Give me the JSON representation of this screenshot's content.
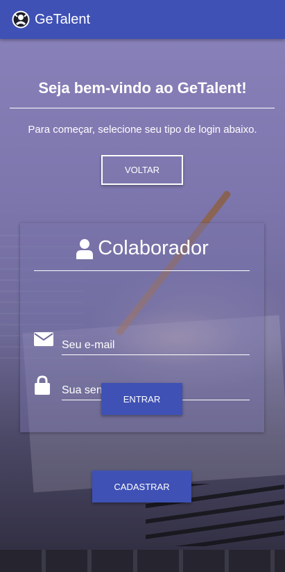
{
  "app": {
    "title": "GeTalent",
    "logo_icon": "getalent-logo-icon",
    "bar_color": "#3f51b5"
  },
  "welcome": {
    "heading": "Seja bem-vindo ao GeTalent!",
    "subtitle": "Para começar, selecione seu tipo de login abaixo.",
    "back_label": "VOLTAR"
  },
  "login_card": {
    "title": "Colaborador",
    "title_icon": "user-icon",
    "email": {
      "icon": "envelope-icon",
      "placeholder": "Seu e-mail",
      "value": ""
    },
    "password": {
      "icon": "lock-icon",
      "placeholder": "Sua senha",
      "value": ""
    },
    "submit_label": "ENTRAR"
  },
  "register_label": "CADASTRAR"
}
